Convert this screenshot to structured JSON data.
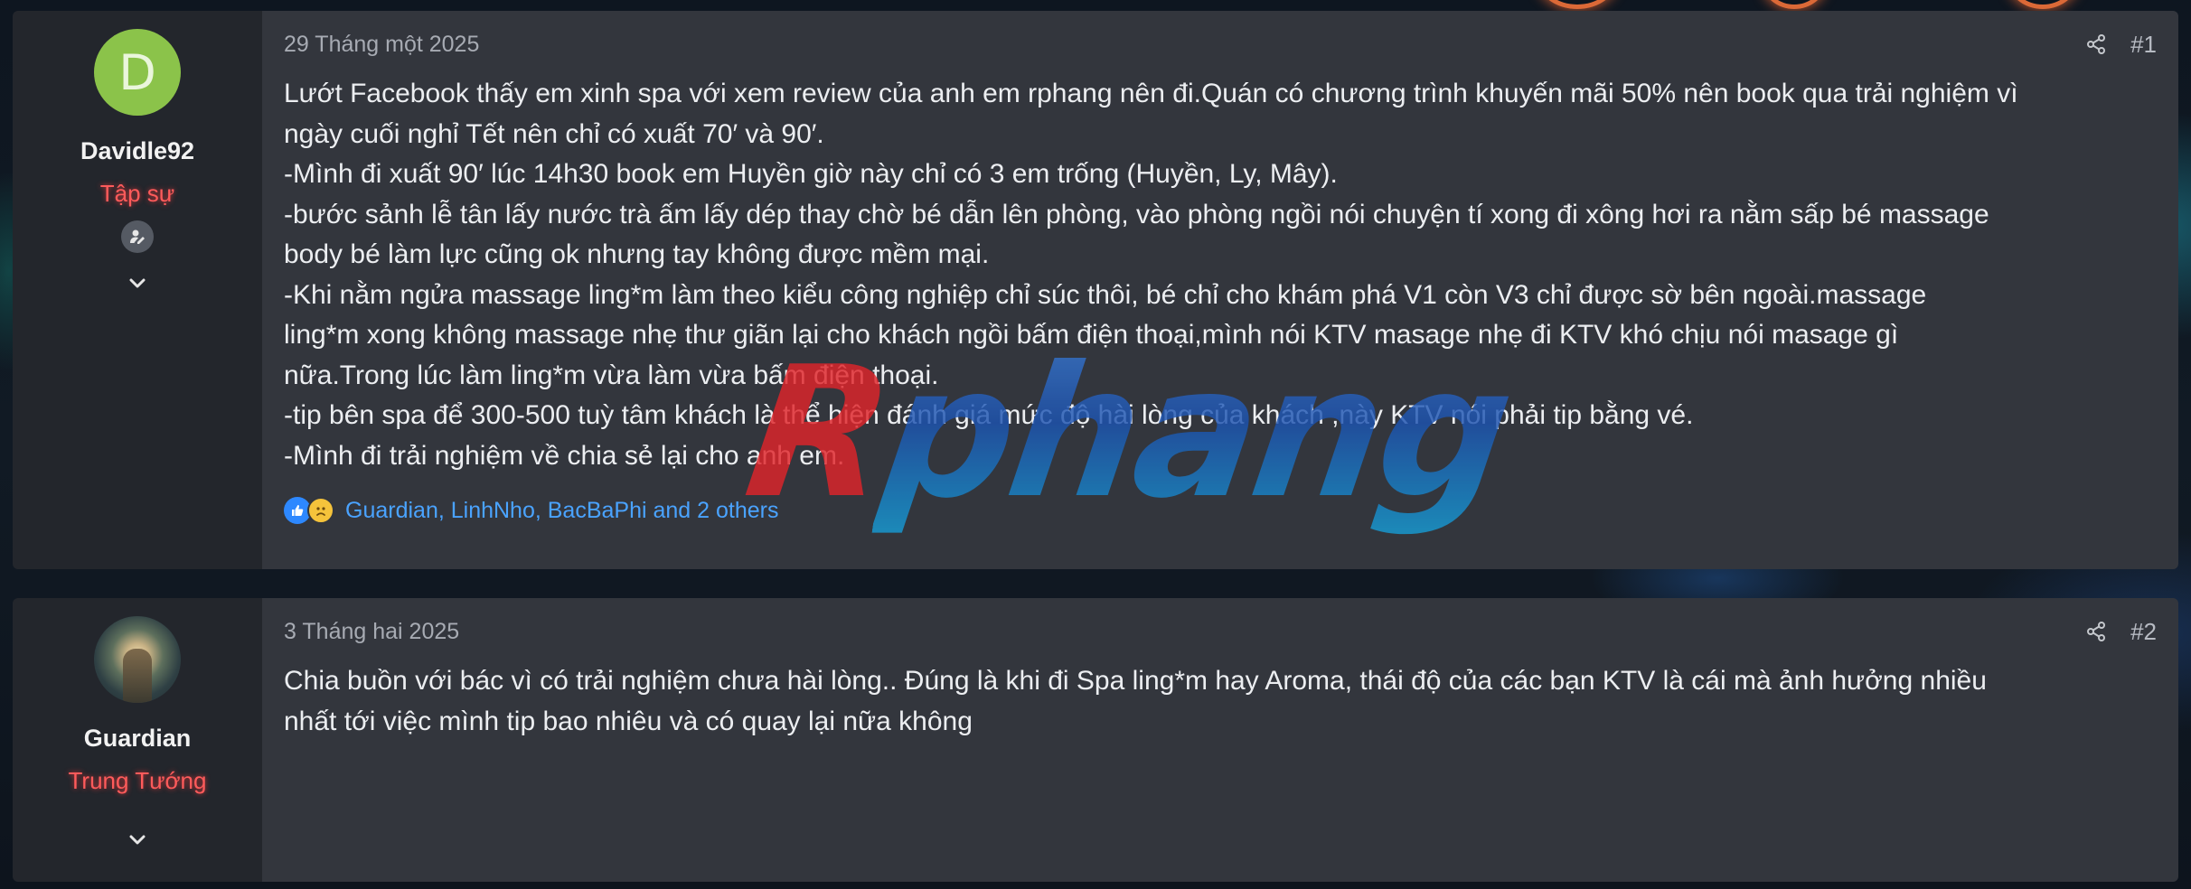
{
  "colors": {
    "avatar_d": "#8bc34a",
    "user_title": "#ff5b5b",
    "reaction_link": "#4aa3ff",
    "watermark_red": "#e0242a",
    "watermark_blue": "#1d53b0"
  },
  "watermark": {
    "text_a": "R",
    "text_b": "phang"
  },
  "posts": [
    {
      "avatar_letter": "D",
      "username": "Davidle92",
      "user_title": "Tập sự",
      "badge_icon": "user-edit-icon",
      "date": "29 Tháng một 2025",
      "number": "#1",
      "body": "Lướt Facebook thấy em xinh spa với xem review của anh em rphang nên đi.Quán có chương trình khuyến mãi 50% nên book qua trải nghiệm vì\nngày cuối nghỉ Tết nên chỉ có xuất 70′ và 90′.\n-Mình đi xuất 90′ lúc 14h30 book em Huyền giờ này chỉ có 3 em trống (Huyền, Ly, Mây).\n-bước sảnh lễ tân lấy nước trà ấm lấy dép thay chờ bé dẫn lên phòng, vào phòng ngồi nói chuyện tí xong đi xông hơi ra nằm sấp bé massage\nbody bé làm lực cũng ok nhưng tay không được mềm mại.\n-Khi nằm ngửa massage ling*m làm theo kiểu công nghiệp chỉ súc thôi, bé chỉ cho khám phá V1 còn V3 chỉ được sờ bên ngoài.massage\nling*m xong không massage nhẹ thư giãn lại cho khách ngồi bấm điện thoại,mình nói KTV masage nhẹ đi KTV khó chịu nói masage gì\nnữa.Trong lúc làm ling*m vừa làm vừa bấm điện thoại.\n-tip bên spa để 300-500 tuỳ tâm khách là thể hiện đánh giá mức độ hài lòng của khách ,này KTV nói phải tip bằng vé.\n-Mình đi trải nghiệm về chia sẻ lại cho anh em.",
      "reactions_text": "Guardian, LinhNho, BacBaPhi and 2 others"
    },
    {
      "username": "Guardian",
      "user_title": "Trung Tướng",
      "date": "3 Tháng hai 2025",
      "number": "#2",
      "body": "Chia buồn với bác vì có trải nghiệm chưa hài lòng.. Đúng là khi đi Spa ling*m hay Aroma, thái độ của các bạn KTV là cái mà ảnh hưởng nhiều\nnhất tới việc mình tip bao nhiêu và có quay lại nữa không"
    }
  ]
}
